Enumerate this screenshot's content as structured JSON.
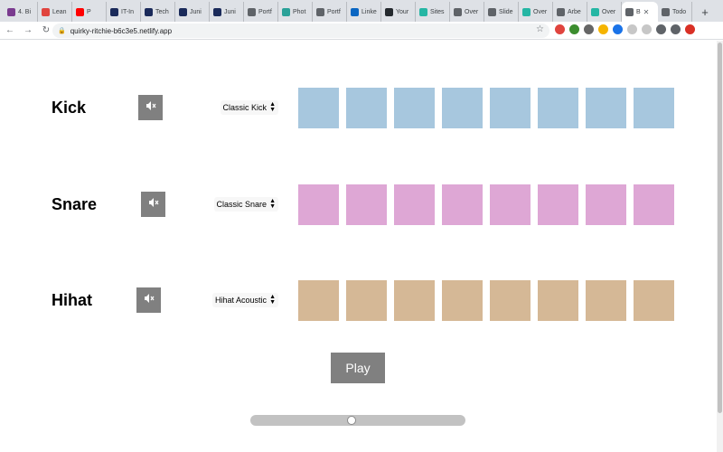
{
  "browser": {
    "tabs": [
      {
        "label": "4. Bi",
        "color": "#7a3b8f"
      },
      {
        "label": "Lean",
        "color": "#e0443e"
      },
      {
        "label": "P",
        "color": "#ff0000"
      },
      {
        "label": "IT-In",
        "color": "#1a2a5a"
      },
      {
        "label": "Tech",
        "color": "#1a2a5a"
      },
      {
        "label": "Juni",
        "color": "#1a2a5a"
      },
      {
        "label": "Juni",
        "color": "#1a2a5a"
      },
      {
        "label": "Portf",
        "color": "#5f6368"
      },
      {
        "label": "Phot",
        "color": "#2aa198"
      },
      {
        "label": "Portf",
        "color": "#5f6368"
      },
      {
        "label": "Linke",
        "color": "#0a66c2"
      },
      {
        "label": "Your",
        "color": "#24292e"
      },
      {
        "label": "Sites",
        "color": "#25b6a4"
      },
      {
        "label": "Over",
        "color": "#5f6368"
      },
      {
        "label": "Slide",
        "color": "#5f6368"
      },
      {
        "label": "Over",
        "color": "#25b6a4"
      },
      {
        "label": "Arbe",
        "color": "#5f6368"
      },
      {
        "label": "Over",
        "color": "#25b6a4"
      },
      {
        "label": "B",
        "color": "#5f6368",
        "active": true
      },
      {
        "label": "Todo",
        "color": "#5f6368"
      }
    ],
    "url": "quirky-ritchie-b6c3e5.netlify.app",
    "extension_colors": [
      "#e0443e",
      "#3c8d2f",
      "#666666",
      "#f5b400",
      "#1a73e8",
      "#c7c7c7",
      "#c7c7c7",
      "#5f6368",
      "#5f6368",
      "#d93025"
    ]
  },
  "tracks": [
    {
      "name": "Kick",
      "sound": "Classic Kick",
      "pad_color": "#a7c7de",
      "pads": 8
    },
    {
      "name": "Snare",
      "sound": "Classic Snare",
      "pad_color": "#dea7d5",
      "pads": 8
    },
    {
      "name": "Hihat",
      "sound": "Hihat Acoustic",
      "pad_color": "#d5b896",
      "pads": 8
    }
  ],
  "controls": {
    "play_label": "Play",
    "tempo_level": 0.47
  }
}
